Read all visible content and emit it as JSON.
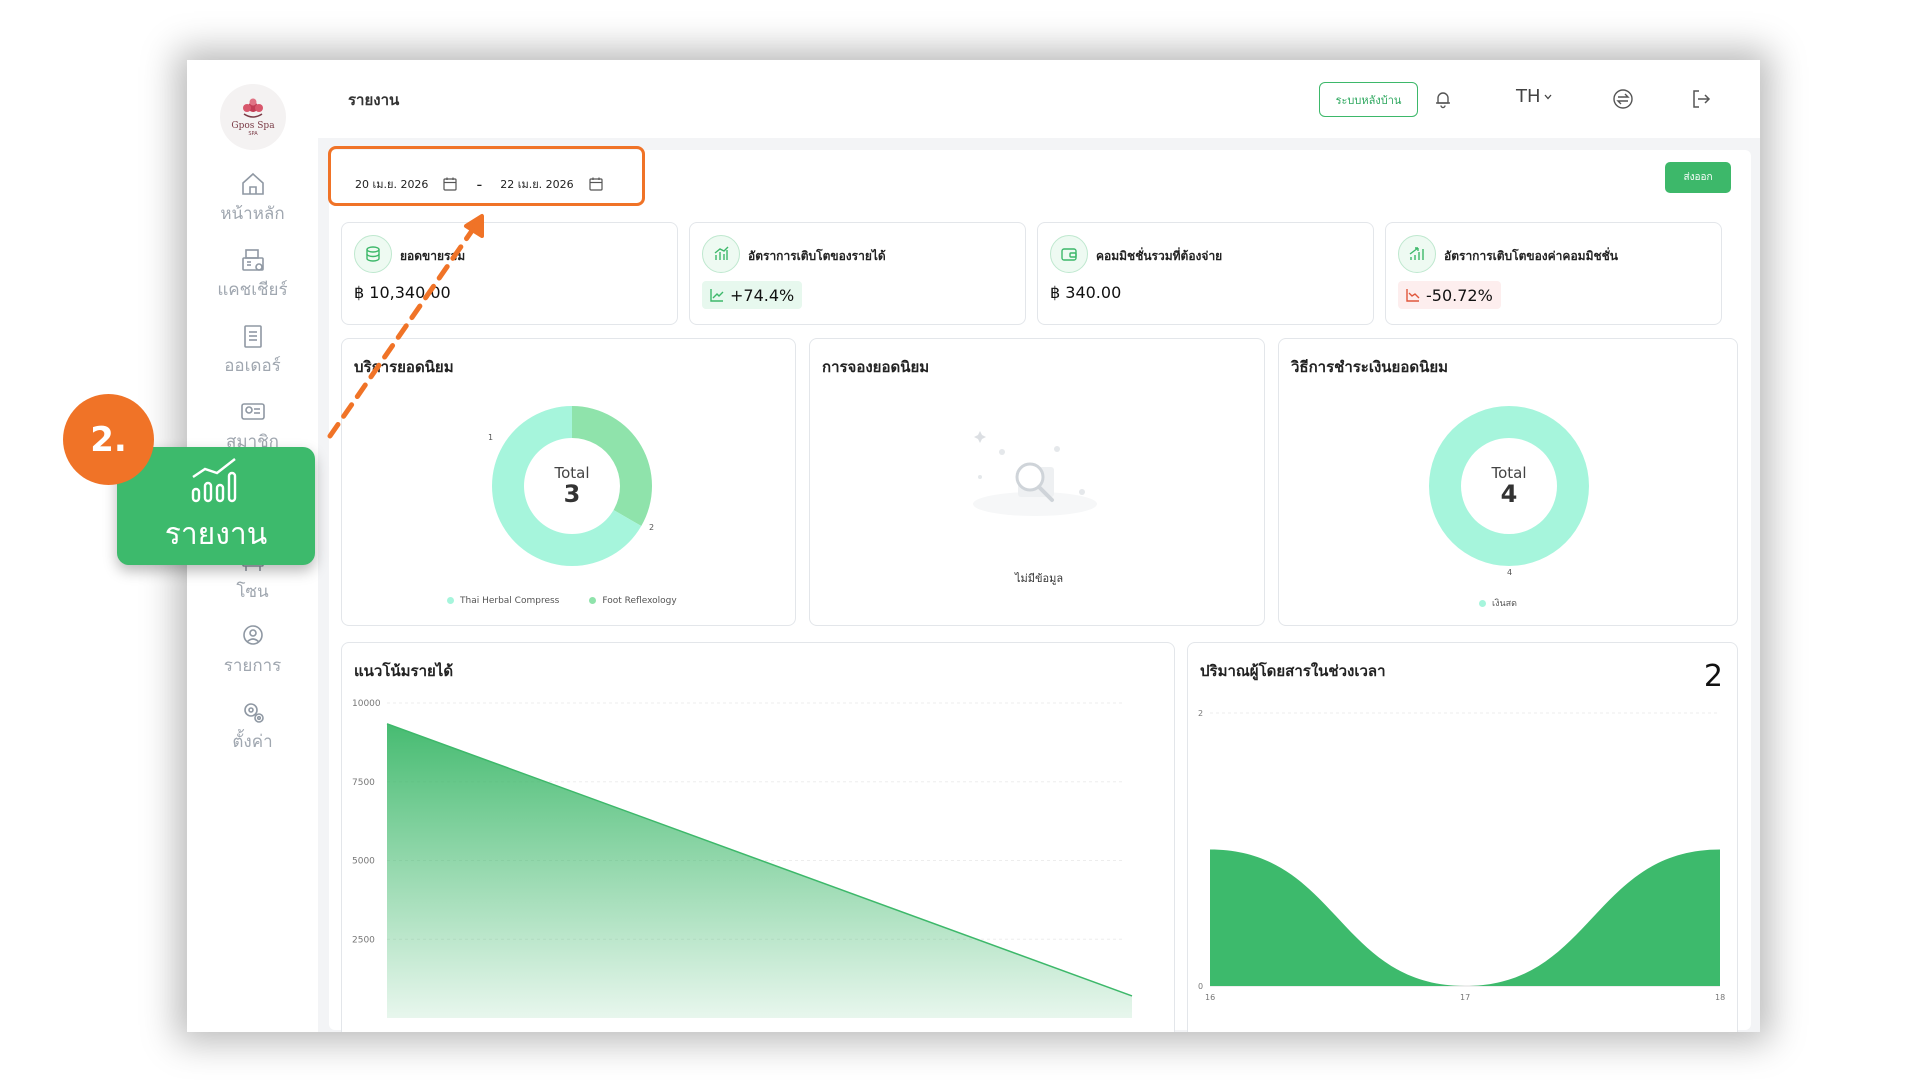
{
  "header": {
    "page_title": "รายงาน",
    "backoffice_label": "ระบบหลังบ้าน",
    "language": "TH",
    "icons": [
      "bell-icon",
      "switch-icon",
      "logout-icon"
    ]
  },
  "brand": {
    "name": "Gpos Spa",
    "sub": "SPA"
  },
  "sidebar": {
    "items": [
      {
        "label": "หน้าหลัก",
        "icon": "home-icon"
      },
      {
        "label": "แคชเชียร์",
        "icon": "cashier-icon"
      },
      {
        "label": "ออเดอร์",
        "icon": "order-icon"
      },
      {
        "label": "สมาชิก",
        "icon": "member-icon"
      },
      {
        "label": "โซน",
        "icon": "zone-icon"
      },
      {
        "label": "รายการ",
        "icon": "service-icon"
      },
      {
        "label": "ตั้งค่า",
        "icon": "settings-icon"
      }
    ]
  },
  "date_range": {
    "start": "20 เม.ย. 2026",
    "end": "22 เม.ย. 2026",
    "separator": "-"
  },
  "export_label": "ส่งออก",
  "stats": [
    {
      "title": "ยอดขายรวม",
      "value": "฿ 10,340.00"
    },
    {
      "title": "อัตราการเติบโตของรายได้",
      "value": "+74.4%",
      "trend": "up"
    },
    {
      "title": "คอมมิชชั่นรวมที่ต้องจ่าย",
      "value": "฿ 340.00"
    },
    {
      "title": "อัตราการเติบโตของค่าคอมมิชชั่น",
      "value": "-50.72%",
      "trend": "down"
    }
  ],
  "panels": {
    "services": {
      "title": "บริการยอดนิยม",
      "total_label": "Total",
      "total": "3"
    },
    "bookings": {
      "title": "การจองยอดนิยม",
      "empty_text": "ไม่มีข้อมูล"
    },
    "payments": {
      "title": "วิธีการชำระเงินยอดนิยม",
      "total_label": "Total",
      "total": "4"
    },
    "revenue": {
      "title": "แนวโน้มรายได้"
    },
    "passengers": {
      "title": "ปริมาณผู้โดยสารในช่วงเวลา",
      "count": "2"
    }
  },
  "callout": {
    "step": "2.",
    "label": "รายงาน"
  },
  "colors": {
    "accent": "#3db86a",
    "annotation": "#f07327",
    "donut_a": "#8fe3ab",
    "donut_b": "#a6f5dc"
  },
  "chart_data": [
    {
      "type": "pie",
      "title": "บริการยอดนิยม",
      "labels": [
        "Thai Herbal Compress",
        "Foot Reflexology"
      ],
      "values": [
        1,
        2
      ],
      "colors": [
        "#8fe3ab",
        "#a6f5dc"
      ]
    },
    {
      "type": "pie",
      "title": "วิธีการชำระเงินยอดนิยม",
      "labels": [
        "เงินสด"
      ],
      "values": [
        4
      ],
      "colors": [
        "#a6f5dc"
      ]
    },
    {
      "type": "area",
      "title": "แนวโน้มรายได้",
      "x": [
        0,
        1
      ],
      "values": [
        9340,
        700
      ],
      "ylim": [
        0,
        10000
      ],
      "yticks": [
        "10000",
        "7500",
        "5000",
        "2500"
      ]
    },
    {
      "type": "area",
      "title": "ปริมาณผู้โดยสารในช่วงเวลา",
      "x": [
        "16",
        "17",
        "18"
      ],
      "values": [
        1,
        0,
        1
      ],
      "ylim": [
        0,
        2
      ],
      "yticks": [
        "2",
        "0"
      ]
    }
  ]
}
